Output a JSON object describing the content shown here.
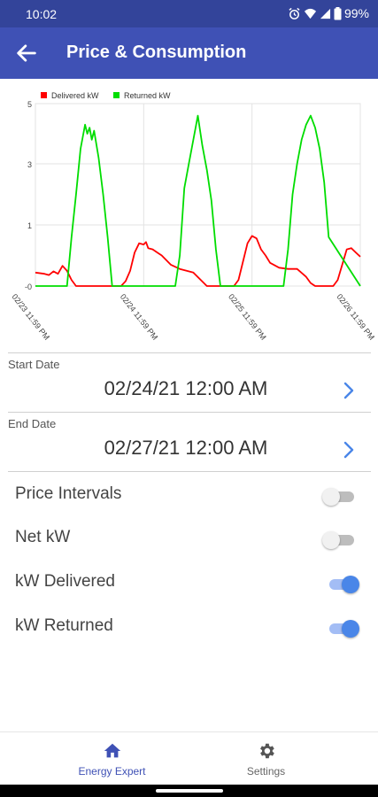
{
  "status": {
    "time": "10:02",
    "battery": "99%"
  },
  "header": {
    "title": "Price & Consumption"
  },
  "chart_data": {
    "type": "line",
    "legend": [
      "Delivered kW",
      "Returned kW"
    ],
    "legend_position": "top-left",
    "y_ticks": [
      "-0",
      "1",
      "3",
      "5"
    ],
    "x_tick_labels": [
      "02/23 11:59 PM",
      "02/24 11:59 PM",
      "02/25 11:59 PM",
      "02/26 11:59 PM"
    ],
    "x_tick_positions": [
      0,
      24,
      48,
      72
    ],
    "xlim": [
      0,
      72
    ],
    "colors": {
      "delivered": "#ff0000",
      "returned": "#00dd00"
    },
    "series": [
      {
        "name": "Delivered kW",
        "x": [
          0,
          2,
          3,
          4,
          5,
          6,
          7,
          8,
          9,
          12,
          16,
          18,
          19,
          20,
          21,
          22,
          23,
          24,
          24.5,
          25,
          26,
          27,
          28,
          30,
          32,
          35,
          38,
          40,
          42,
          43,
          44,
          45,
          46,
          47,
          48,
          49,
          50,
          51,
          52,
          54,
          56,
          58,
          60,
          61,
          62,
          63,
          64,
          66,
          67,
          68,
          69,
          70,
          71,
          72
        ],
        "y": [
          0.22,
          0.2,
          0.18,
          0.24,
          0.2,
          0.33,
          0.25,
          0.1,
          0,
          0,
          0,
          0,
          0,
          0.08,
          0.25,
          0.55,
          0.7,
          0.68,
          0.72,
          0.62,
          0.6,
          0.55,
          0.5,
          0.35,
          0.28,
          0.22,
          0,
          0,
          0,
          0,
          0,
          0.1,
          0.4,
          0.7,
          0.82,
          0.78,
          0.6,
          0.5,
          0.38,
          0.3,
          0.28,
          0.28,
          0.15,
          0.05,
          0,
          0,
          0,
          0,
          0.1,
          0.35,
          0.6,
          0.62,
          0.55,
          0.48
        ]
      },
      {
        "name": "Returned kW",
        "x": [
          0,
          7,
          8,
          9,
          10,
          11,
          11.5,
          12,
          12.5,
          13,
          14,
          15,
          16,
          17,
          24,
          31,
          32,
          33,
          34,
          35,
          36,
          37,
          38,
          39,
          40,
          41,
          48,
          55,
          56,
          57,
          58,
          59,
          60,
          61,
          62,
          63,
          64,
          65,
          72
        ],
        "y": [
          0,
          0,
          0.8,
          2,
          3.5,
          4.3,
          4,
          4.2,
          3.8,
          4.1,
          3.2,
          2,
          0.8,
          0,
          0,
          0,
          0.5,
          2.2,
          3,
          3.8,
          4.6,
          3.6,
          2.8,
          1.8,
          0.6,
          0,
          0,
          0,
          0.6,
          2,
          3,
          3.8,
          4.3,
          4.6,
          4.2,
          3.5,
          2.4,
          0.8,
          0
        ]
      }
    ]
  },
  "dates": {
    "start_label": "Start Date",
    "start_value": "02/24/21 12:00 AM",
    "end_label": "End Date",
    "end_value": "02/27/21 12:00 AM"
  },
  "toggles": [
    {
      "label": "Price Intervals",
      "state": "off"
    },
    {
      "label": "Net kW",
      "state": "off"
    },
    {
      "label": "kW Delivered",
      "state": "on"
    },
    {
      "label": "kW Returned",
      "state": "on"
    }
  ],
  "nav": {
    "items": [
      {
        "label": "Energy Expert",
        "icon": "home-icon",
        "active": true
      },
      {
        "label": "Settings",
        "icon": "gear-icon",
        "active": false
      }
    ]
  },
  "colors": {
    "primary": "#3f51b5",
    "status_bar": "#33449a",
    "accent": "#4a86e8",
    "nav_active": "#3f51b5",
    "nav_inactive": "#666666"
  }
}
